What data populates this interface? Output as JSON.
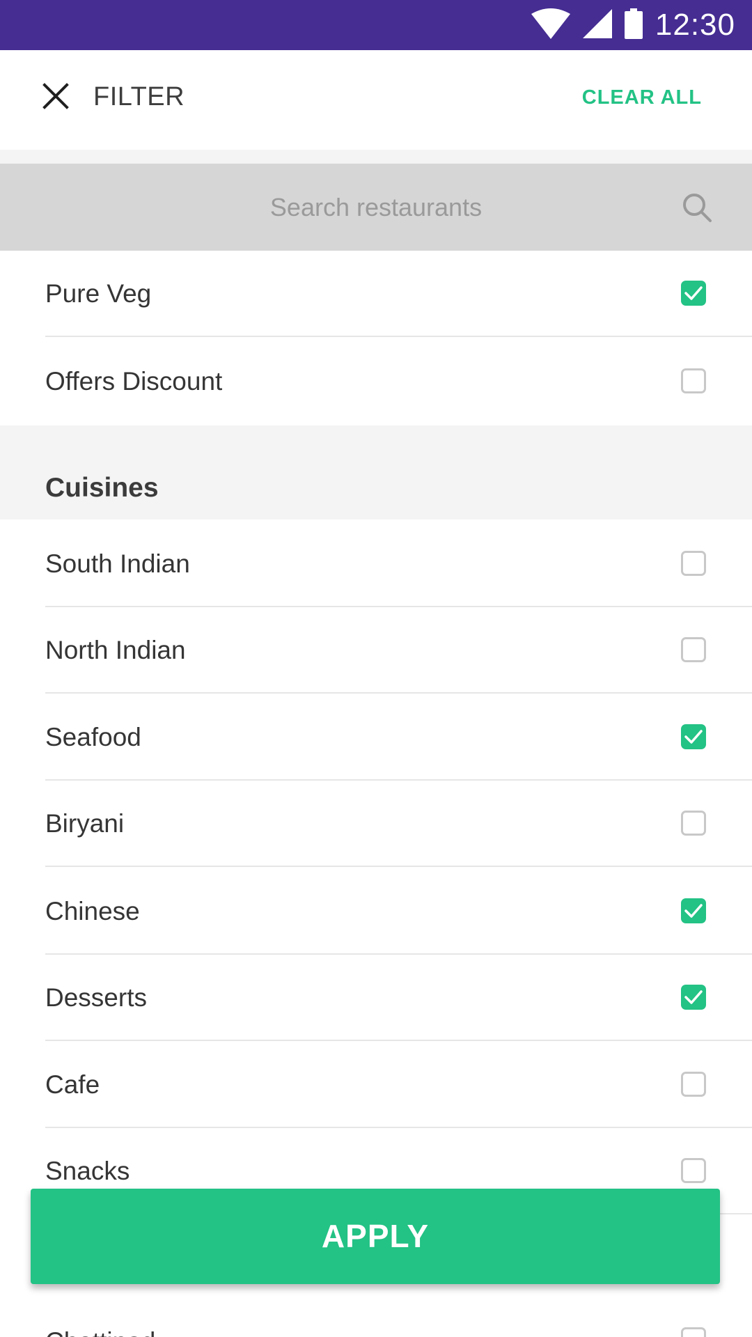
{
  "status_bar": {
    "time": "12:30",
    "icons": [
      "wifi-icon",
      "signal-icon",
      "battery-icon"
    ],
    "background": "#452d92"
  },
  "toolbar": {
    "title": "FILTER",
    "clear_all_label": "CLEAR ALL",
    "accent": "#23c285"
  },
  "search": {
    "placeholder": "Search restaurants",
    "value": ""
  },
  "quick_filters": [
    {
      "label": "Pure Veg",
      "checked": true
    },
    {
      "label": "Offers Discount",
      "checked": false
    }
  ],
  "cuisines_section": {
    "title": "Cuisines",
    "items": [
      {
        "label": "South Indian",
        "checked": false
      },
      {
        "label": "North Indian",
        "checked": false
      },
      {
        "label": "Seafood",
        "checked": true
      },
      {
        "label": "Biryani",
        "checked": false
      },
      {
        "label": "Chinese",
        "checked": true
      },
      {
        "label": "Desserts",
        "checked": true
      },
      {
        "label": "Cafe",
        "checked": false
      },
      {
        "label": "Snacks",
        "checked": false
      },
      {
        "label": "Chettinad",
        "checked": false
      }
    ]
  },
  "apply_button": {
    "label": "APPLY"
  }
}
